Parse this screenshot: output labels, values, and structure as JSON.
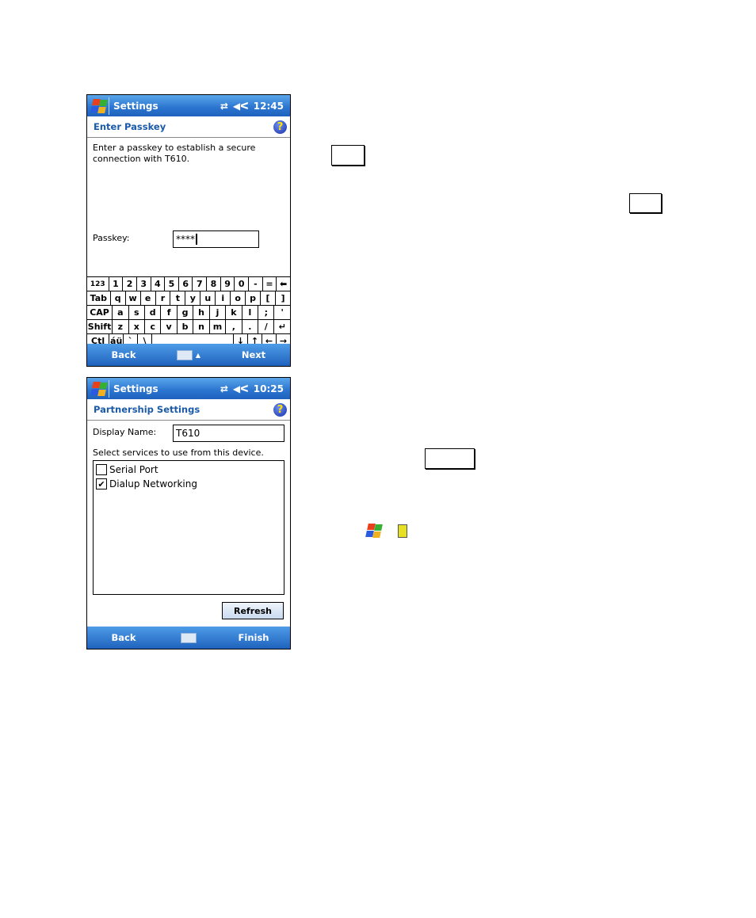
{
  "screen1": {
    "title": "Settings",
    "time": "12:45",
    "header": "Enter Passkey",
    "help": "?",
    "instruction": "Enter a passkey to establish a secure connection with T610.",
    "passkey_label": "Passkey:",
    "passkey_value": "****",
    "keyboard": [
      [
        "123",
        "1",
        "2",
        "3",
        "4",
        "5",
        "6",
        "7",
        "8",
        "9",
        "0",
        "-",
        "=",
        "⬅"
      ],
      [
        "Tab",
        "q",
        "w",
        "e",
        "r",
        "t",
        "y",
        "u",
        "i",
        "o",
        "p",
        "[",
        "]"
      ],
      [
        "CAP",
        "a",
        "s",
        "d",
        "f",
        "g",
        "h",
        "j",
        "k",
        "l",
        ";",
        "'"
      ],
      [
        "Shift",
        "z",
        "x",
        "c",
        "v",
        "b",
        "n",
        "m",
        ",",
        ".",
        "/",
        "↵"
      ],
      [
        "Ctl",
        "áü",
        "`",
        "\\",
        " ",
        "↓",
        "↑",
        "←",
        "→"
      ]
    ],
    "menu_left": "Back",
    "menu_right": "Next",
    "menu_arrow": "▲"
  },
  "screen2": {
    "title": "Settings",
    "time": "10:25",
    "header": "Partnership Settings",
    "help": "?",
    "display_name_label": "Display Name:",
    "display_name_value": "T610",
    "services_label": "Select services to use from this device.",
    "services": [
      {
        "label": "Serial Port",
        "checked": false
      },
      {
        "label": "Dialup Networking",
        "checked": true
      }
    ],
    "refresh": "Refresh",
    "menu_left": "Back",
    "menu_right": "Finish"
  },
  "icons": {
    "start": "windows-flag-icon",
    "device": "battery-icon"
  },
  "colors": {
    "title_bar": "#2a74cf",
    "header_text": "#1b5aa8"
  }
}
